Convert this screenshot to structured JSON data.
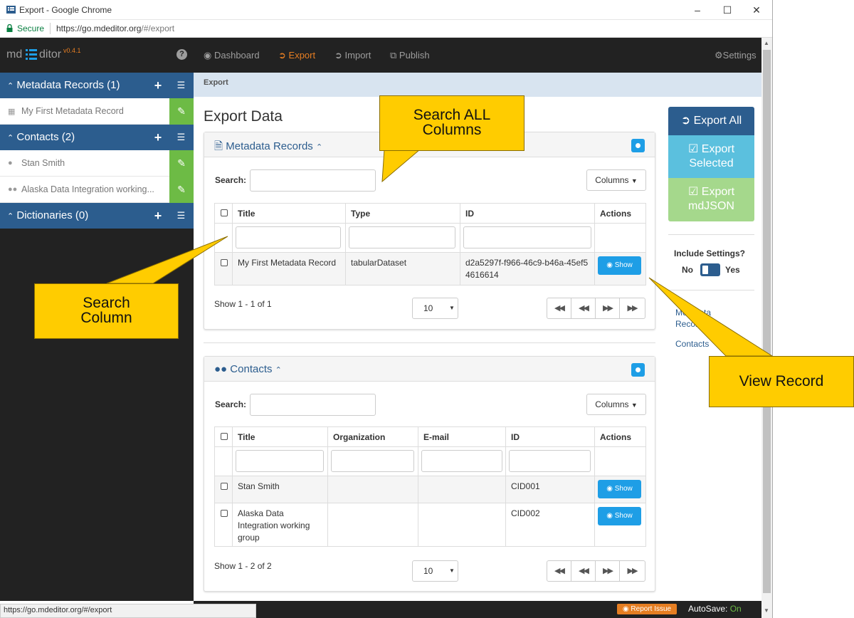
{
  "browser": {
    "window_title": "Export - Google Chrome",
    "secure_label": "Secure",
    "url_host": "https://go.mdeditor.org",
    "url_path": "/#/export",
    "status_url": "https://go.mdeditor.org/#/export"
  },
  "brand": {
    "prefix": "md",
    "suffix": "ditor",
    "version": "v0.4.1",
    "help": "?"
  },
  "sidebar": {
    "sections": [
      {
        "label": "Metadata Records (1)",
        "items": [
          {
            "label": "My First Metadata Record"
          }
        ]
      },
      {
        "label": "Contacts (2)",
        "items": [
          {
            "label": "Stan Smith"
          },
          {
            "label": "Alaska Data Integration working..."
          }
        ]
      },
      {
        "label": "Dictionaries (0)",
        "items": []
      }
    ]
  },
  "nav": {
    "dashboard": "Dashboard",
    "export": "Export",
    "import": "Import",
    "publish": "Publish",
    "settings": "Settings"
  },
  "breadcrumb": "Export",
  "page_title": "Export Data",
  "metadata_panel": {
    "title": "Metadata Records",
    "search_label": "Search:",
    "columns_button": "Columns",
    "headers": [
      "Title",
      "Type",
      "ID",
      "Actions"
    ],
    "rows": [
      {
        "title": "My First Metadata Record",
        "type": "tabularDataset",
        "id": "d2a5297f-f966-46c9-b46a-45ef54616614",
        "action": "Show"
      }
    ],
    "summary": "Show 1 - 1 of 1",
    "page_size": "10"
  },
  "contacts_panel": {
    "title": "Contacts",
    "search_label": "Search:",
    "columns_button": "Columns",
    "headers": [
      "Title",
      "Organization",
      "E-mail",
      "ID",
      "Actions"
    ],
    "rows": [
      {
        "title": "Stan Smith",
        "organization": "",
        "email": "",
        "id": "CID001",
        "action": "Show"
      },
      {
        "title": "Alaska Data Integration working group",
        "organization": "",
        "email": "",
        "id": "CID002",
        "action": "Show"
      }
    ],
    "summary": "Show 1 - 2 of 2",
    "page_size": "10"
  },
  "actions": {
    "export_all": "Export All",
    "export_selected": "Export Selected",
    "export_mdjson": "Export mdJSON",
    "include_settings": "Include Settings?",
    "no": "No",
    "yes": "Yes",
    "link_metadata": "Metadata Records",
    "link_contacts": "Contacts"
  },
  "footer": {
    "report_issue": "Report Issue",
    "autosave_label": "AutoSave:",
    "autosave_value": "On"
  },
  "callouts": {
    "search_all": "Search ALL Columns",
    "search_column": "Search Column",
    "view_record": "View Record"
  },
  "colors": {
    "brand_blue": "#2c5d8e",
    "accent_orange": "#e67e22",
    "edit_green": "#6dbb45",
    "info_blue": "#1e9ee6",
    "callout_yellow": "#ffcc00"
  }
}
